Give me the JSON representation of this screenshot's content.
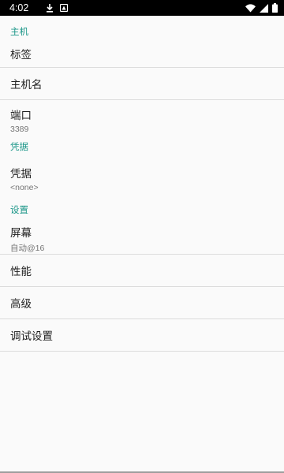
{
  "status_bar": {
    "time": "4:02",
    "icons": [
      "download-icon",
      "app-notification-icon",
      "wifi-icon",
      "cell-signal-icon",
      "battery-icon"
    ]
  },
  "sections": {
    "host": {
      "header": "主机",
      "label_item": {
        "title": "标签"
      },
      "hostname_item": {
        "title": "主机名"
      },
      "port_item": {
        "title": "端口",
        "summary": "3389"
      }
    },
    "credentials": {
      "header": "凭据",
      "credentials_item": {
        "title": "凭据",
        "summary": "<none>"
      }
    },
    "settings": {
      "header": "设置",
      "screen_item": {
        "title": "屏幕",
        "summary": "自动@16"
      },
      "performance_item": {
        "title": "性能"
      },
      "advanced_item": {
        "title": "高级"
      },
      "debug_item": {
        "title": "调试设置"
      }
    }
  },
  "colors": {
    "accent": "#1b9688",
    "background": "#fafafa",
    "status_bar": "#000000",
    "divider": "#dcdcdc"
  }
}
